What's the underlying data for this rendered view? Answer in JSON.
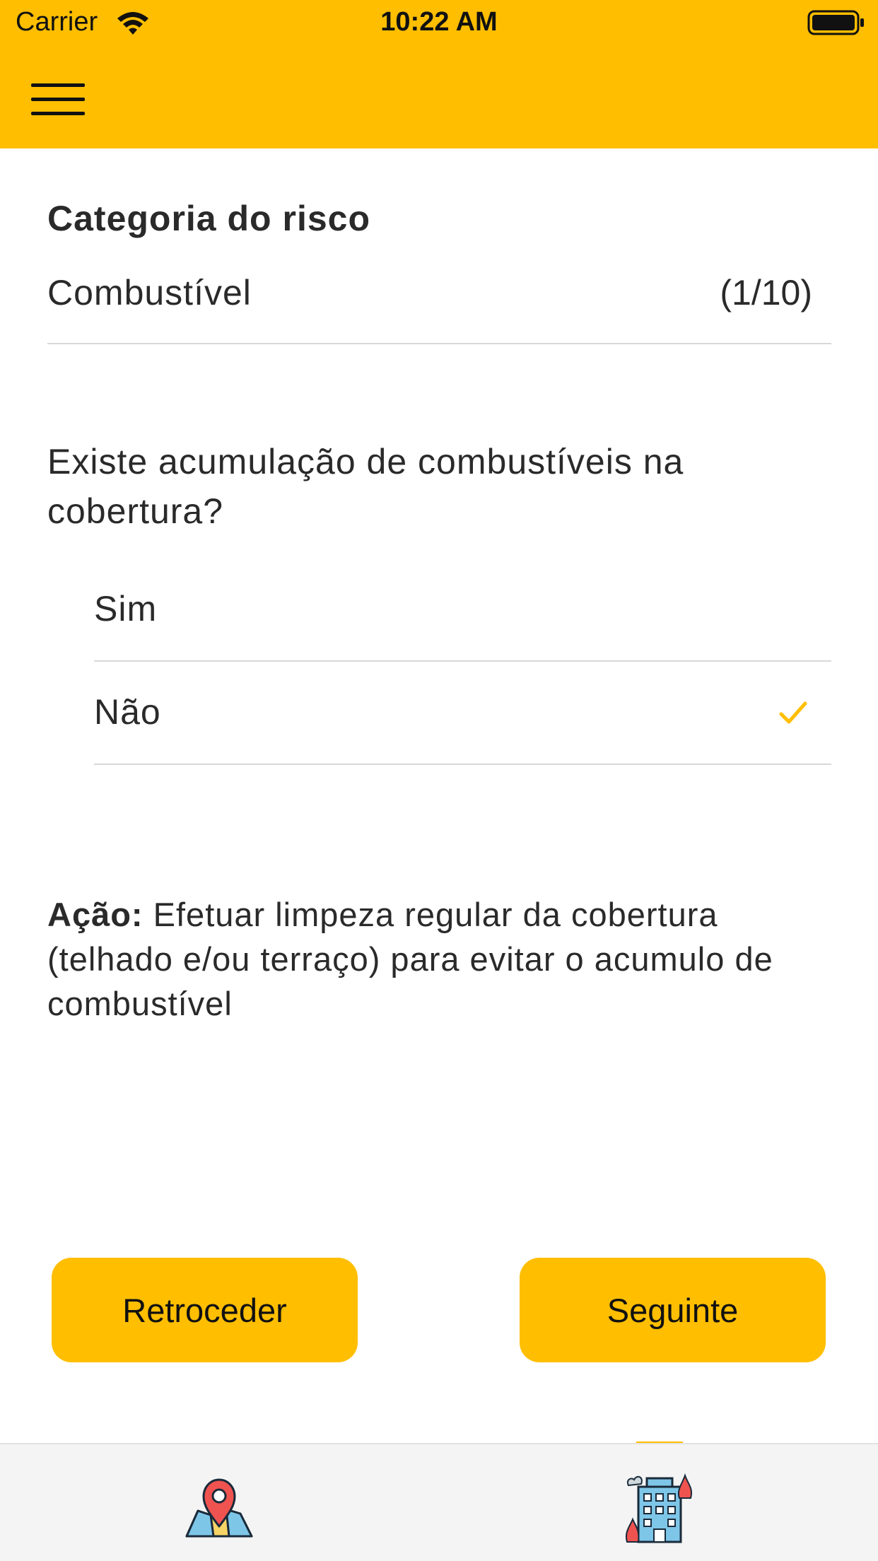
{
  "status_bar": {
    "carrier": "Carrier",
    "time": "10:22 AM"
  },
  "header": {
    "background_color": "#FFBE00",
    "menu_icon": "hamburger-icon"
  },
  "category": {
    "title": "Categoria do risco",
    "value": "Combustível",
    "progress": "(1/10)"
  },
  "question": {
    "text": "Existe acumulação de combustíveis na cobertura?",
    "options": [
      {
        "label": "Sim",
        "selected": false
      },
      {
        "label": "Não",
        "selected": true
      }
    ]
  },
  "action": {
    "label": "Ação:",
    "text": " Efetuar limpeza regular da cobertura (telhado e/ou terraço) para evitar o acumulo de combustível"
  },
  "buttons": {
    "back_label": "Retroceder",
    "next_label": "Seguinte"
  },
  "tabbar": {
    "tabs": [
      {
        "icon": "map-pin-icon",
        "selected": false
      },
      {
        "icon": "burning-building-icon",
        "selected": true
      }
    ]
  }
}
